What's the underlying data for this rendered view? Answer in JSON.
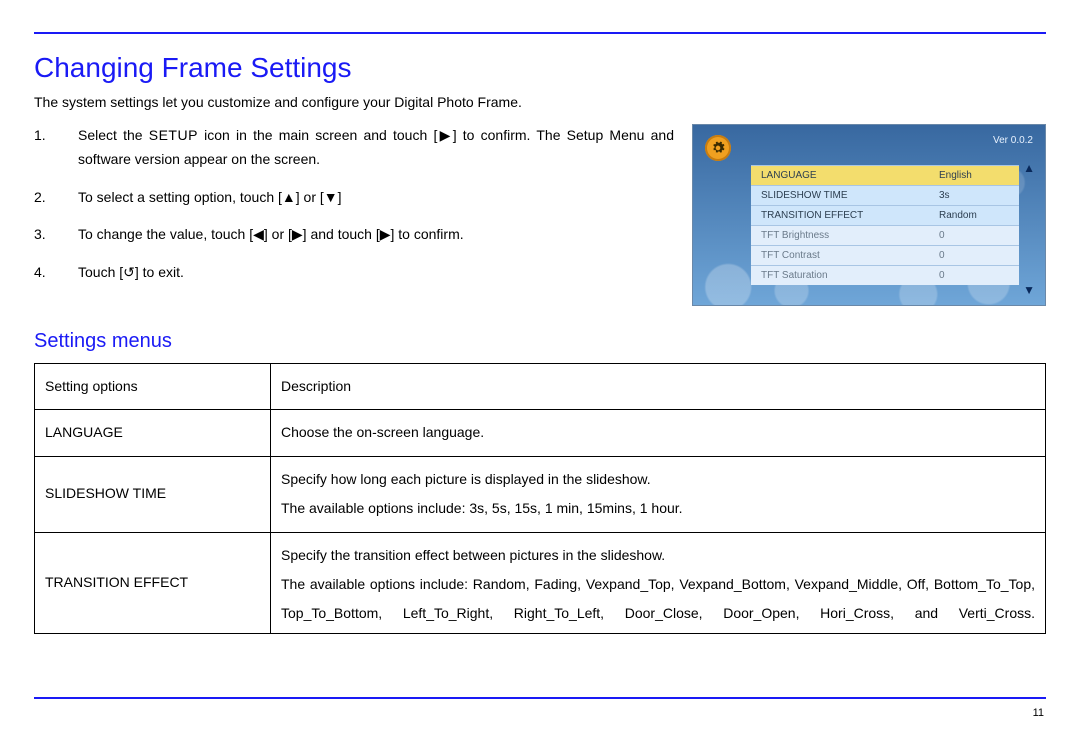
{
  "page": {
    "title": "Changing Frame Settings",
    "intro": "The system settings let you customize and configure your Digital Photo Frame.",
    "subtitle": "Settings menus",
    "pageNumber": "11"
  },
  "steps": {
    "s1_num": "1.",
    "s1_a": "Select the ",
    "s1_setup": "SETUP",
    "s1_b": " icon in the main screen and touch [▶] to confirm. The Setup Menu and software version appear on the screen.",
    "s2_num": "2.",
    "s2": "To select a setting option, touch [▲] or [▼]",
    "s3_num": "3.",
    "s3": "To change the value, touch [◀] or [▶] and touch [▶] to confirm.",
    "s4_num": "4.",
    "s4": "Touch [↺] to exit."
  },
  "screenshot": {
    "version": "Ver 0.0.2",
    "rows": [
      {
        "label": "LANGUAGE",
        "value": "English"
      },
      {
        "label": "SLIDESHOW TIME",
        "value": "3s"
      },
      {
        "label": "TRANSITION EFFECT",
        "value": "Random"
      },
      {
        "label": "TFT Brightness",
        "value": "0"
      },
      {
        "label": "TFT Contrast",
        "value": "0"
      },
      {
        "label": "TFT Saturation",
        "value": "0"
      }
    ]
  },
  "table": {
    "head_opt": "Setting options",
    "head_desc": "Description",
    "r1_opt": "LANGUAGE",
    "r1_desc": "Choose the on-screen language.",
    "r2_opt": "SLIDESHOW TIME",
    "r2_desc_a": "Specify how long each picture is displayed in the slideshow.",
    "r2_desc_b": "The available options include: 3s, 5s, 15s, 1 min, 15mins, 1 hour.",
    "r3_opt": "TRANSITION EFFECT",
    "r3_desc_a": "Specify the transition effect between pictures in the slideshow.",
    "r3_desc_b": "The available options include: Random, Fading, Vexpand_Top, Vexpand_Bottom, Vexpand_Middle, Off, Bottom_To_Top, Top_To_Bottom, Left_To_Right, Right_To_Left, Door_Close, Door_Open, Hori_Cross, and Verti_Cross."
  }
}
